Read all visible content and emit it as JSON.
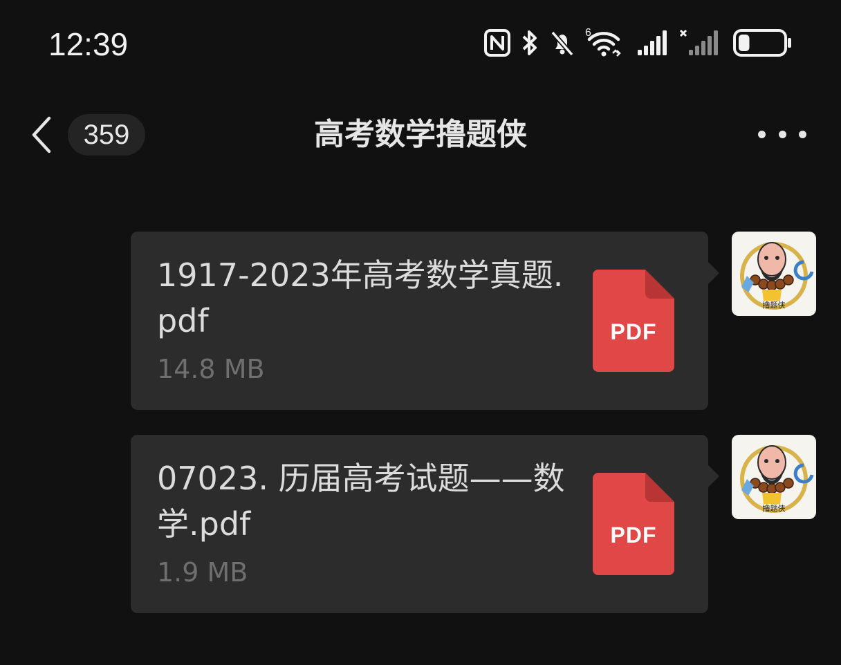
{
  "status_bar": {
    "time": "12:39",
    "icons": [
      "nfc-icon",
      "bluetooth-icon",
      "mute-icon",
      "wifi-6-icon",
      "signal-icon",
      "signal-no-service-icon",
      "battery-icon"
    ],
    "wifi_label": "6",
    "battery_level": 0.25
  },
  "header": {
    "unread_count": "359",
    "title": "高考数学撸题侠"
  },
  "messages": [
    {
      "file_name": "1917-2023年高考数学真题.pdf",
      "file_size": "14.8 MB",
      "file_type_label": "PDF",
      "avatar_caption": "撸题侠"
    },
    {
      "file_name": "07023. 历届高考试题——数学.pdf",
      "file_size": "1.9 MB",
      "file_type_label": "PDF",
      "avatar_caption": "撸题侠"
    }
  ],
  "colors": {
    "background": "#111111",
    "bubble": "#2c2c2c",
    "pdf_red": "#e04848",
    "pdf_fold": "#b93434"
  }
}
